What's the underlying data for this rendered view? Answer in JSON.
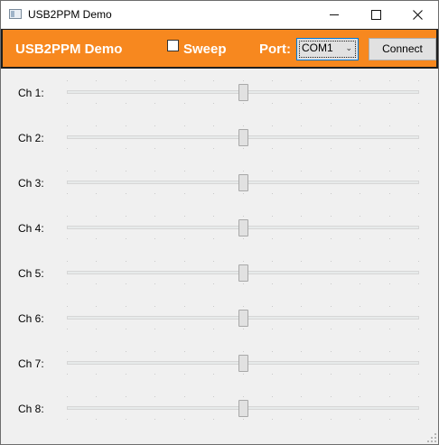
{
  "window": {
    "title": "USB2PPM Demo",
    "icon": "app-window-icon"
  },
  "header": {
    "title": "USB2PPM Demo",
    "sweep_label": "Sweep",
    "sweep_checked": false,
    "port_label": "Port:",
    "port_value": "COM1",
    "connect_label": "Connect",
    "accent_color": "#f7881f"
  },
  "channels": [
    {
      "label": "Ch 1:",
      "value": 0.5
    },
    {
      "label": "Ch 2:",
      "value": 0.5
    },
    {
      "label": "Ch 3:",
      "value": 0.5
    },
    {
      "label": "Ch 4:",
      "value": 0.5
    },
    {
      "label": "Ch 5:",
      "value": 0.5
    },
    {
      "label": "Ch 6:",
      "value": 0.5
    },
    {
      "label": "Ch 7:",
      "value": 0.5
    },
    {
      "label": "Ch 8:",
      "value": 0.5
    }
  ]
}
